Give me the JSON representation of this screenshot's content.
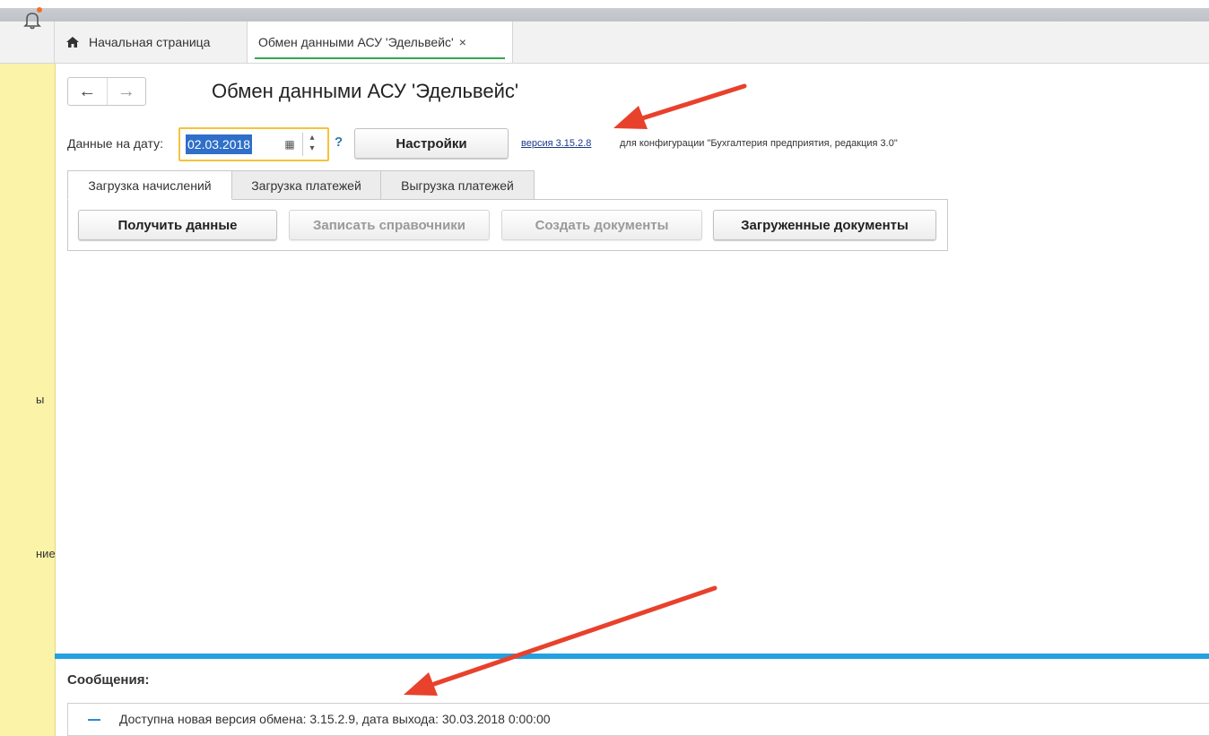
{
  "tabs": {
    "home_label": "Начальная страница",
    "active_label": "Обмен данными АСУ 'Эдельвейс'",
    "close_symbol": "×"
  },
  "left_panel": {
    "text1": "ы",
    "text2": "ние"
  },
  "nav": {
    "back": "←",
    "forward": "→"
  },
  "page": {
    "title": "Обмен данными АСУ 'Эдельвейс'"
  },
  "date": {
    "label": "Данные на дату:",
    "value": "02.03.2018",
    "help": "?"
  },
  "settings_label": "Настройки",
  "version": {
    "link": "версия 3.15.2.8",
    "desc": "для конфигурации \"Бухгалтерия предприятия, редакция 3.0\""
  },
  "form_tabs": [
    "Загрузка начислений",
    "Загрузка платежей",
    "Выгрузка платежей"
  ],
  "actions": {
    "get_data": "Получить данные",
    "write_refs": "Записать справочники",
    "create_docs": "Создать документы",
    "loaded_docs": "Загруженные документы"
  },
  "messages": {
    "title": "Сообщения:",
    "item": "Доступна новая версия обмена: 3.15.2.9, дата выхода: 30.03.2018 0:00:00"
  },
  "colors": {
    "accent_blue": "#23a1e0",
    "highlight_yellow": "#f5c33b",
    "panel_yellow": "#fbf3a8",
    "active_tab_green": "#36a64f",
    "annotation_red": "#e8412c"
  }
}
